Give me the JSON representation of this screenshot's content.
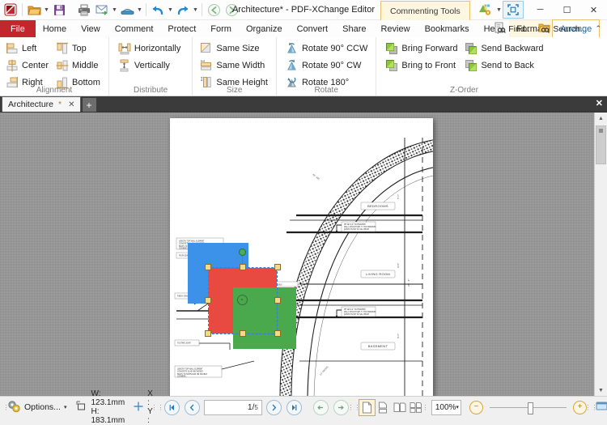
{
  "window": {
    "title": "Architecture* - PDF-XChange Editor",
    "contextual_tab": "Commenting Tools",
    "minimize": "─",
    "maximize": "☐",
    "close": "✕"
  },
  "quick_access": [
    {
      "name": "app-logo",
      "icon": "pdfx-logo"
    },
    {
      "name": "open-file",
      "icon": "folder-open-icon",
      "caret": true
    },
    {
      "name": "save-file",
      "icon": "save-icon",
      "caret": false
    },
    {
      "name": "print",
      "icon": "printer-icon",
      "caret": false
    },
    {
      "name": "email",
      "icon": "envelope-icon",
      "caret": true
    },
    {
      "name": "scan",
      "icon": "scanner-icon",
      "caret": true
    },
    {
      "name": "undo",
      "icon": "undo-icon",
      "caret": true
    },
    {
      "name": "redo",
      "icon": "redo-icon",
      "caret": true
    },
    {
      "name": "back",
      "icon": "arrow-left-circle-icon",
      "caret": false
    },
    {
      "name": "forward",
      "icon": "arrow-right-circle-icon",
      "caret": false
    }
  ],
  "menu": {
    "file": "File",
    "items": [
      "Home",
      "View",
      "Comment",
      "Protect",
      "Form",
      "Organize",
      "Convert",
      "Share",
      "Review",
      "Bookmarks",
      "Help"
    ],
    "format_tab": "Format",
    "arrange_tab": "Arrange",
    "right": {
      "find": "Find...",
      "search": "Search...",
      "collapse": "⌃"
    }
  },
  "ribbon": {
    "groups": [
      {
        "label": "Alignment",
        "columns": [
          {
            "items": [
              {
                "label": "Left",
                "icon": "align-left-icon"
              },
              {
                "label": "Center",
                "icon": "align-center-icon"
              },
              {
                "label": "Right",
                "icon": "align-right-icon"
              }
            ]
          },
          {
            "items": [
              {
                "label": "Top",
                "icon": "align-top-icon"
              },
              {
                "label": "Middle",
                "icon": "align-middle-icon"
              },
              {
                "label": "Bottom",
                "icon": "align-bottom-icon"
              }
            ]
          }
        ]
      },
      {
        "label": "Distribute",
        "columns": [
          {
            "items": [
              {
                "label": "Horizontally",
                "icon": "distribute-horizontal-icon"
              },
              {
                "label": "Vertically",
                "icon": "distribute-vertical-icon"
              }
            ]
          }
        ]
      },
      {
        "label": "Size",
        "columns": [
          {
            "items": [
              {
                "label": "Same Size",
                "icon": "same-size-icon"
              },
              {
                "label": "Same Width",
                "icon": "same-width-icon"
              },
              {
                "label": "Same Height",
                "icon": "same-height-icon"
              }
            ]
          }
        ]
      },
      {
        "label": "Rotate",
        "columns": [
          {
            "items": [
              {
                "label": "Rotate 90° CCW",
                "icon": "rotate-ccw-icon"
              },
              {
                "label": "Rotate 90° CW",
                "icon": "rotate-cw-icon"
              },
              {
                "label": "Rotate 180°",
                "icon": "rotate-180-icon"
              }
            ]
          }
        ]
      },
      {
        "label": "Z-Order",
        "columns": [
          {
            "items": [
              {
                "label": "Bring Forward",
                "icon": "bring-forward-icon"
              },
              {
                "label": "Bring to Front",
                "icon": "bring-to-front-icon"
              }
            ]
          },
          {
            "items": [
              {
                "label": "Send Backward",
                "icon": "send-backward-icon"
              },
              {
                "label": "Send to Back",
                "icon": "send-to-back-icon"
              }
            ]
          }
        ]
      }
    ]
  },
  "tabs": {
    "document": "Architecture",
    "modified_marker": "*",
    "close": "✕",
    "new_tab": "+",
    "panel_close": "✕"
  },
  "document": {
    "room_labels": [
      "BEDROOMS",
      "LIVING ROOM",
      "BASEMENT"
    ],
    "shapes": [
      {
        "name": "blue-square",
        "color": "#3b92e8",
        "selected": false
      },
      {
        "name": "red-square",
        "color": "#e84a42",
        "selected": true
      },
      {
        "name": "green-square",
        "color": "#49a94c",
        "selected": false
      }
    ]
  },
  "statusbar": {
    "options_label": "Options...",
    "options_caret": "▾",
    "size": {
      "width_label": "W: 123.1mm",
      "height_label": "H: 183.1mm"
    },
    "cursor": {
      "x_label": "X :",
      "y_label": "Y :"
    },
    "nav": {
      "first": "⏮",
      "prev": "‹",
      "next": "›",
      "last": "⏭",
      "current_page": "1",
      "page_separator": "/",
      "total_pages": "5",
      "history_back": "←",
      "history_forward": "→"
    },
    "view_modes": [
      {
        "name": "single-page-mode",
        "selected": true
      },
      {
        "name": "continuous-mode",
        "selected": false
      },
      {
        "name": "two-page-mode",
        "selected": false
      },
      {
        "name": "two-page-continuous-mode",
        "selected": false
      }
    ],
    "zoom": {
      "value": "100%",
      "caret": "▾",
      "out": "−",
      "in": "+"
    },
    "fit_button": "fit-page-icon",
    "fit_caret": "▾"
  }
}
